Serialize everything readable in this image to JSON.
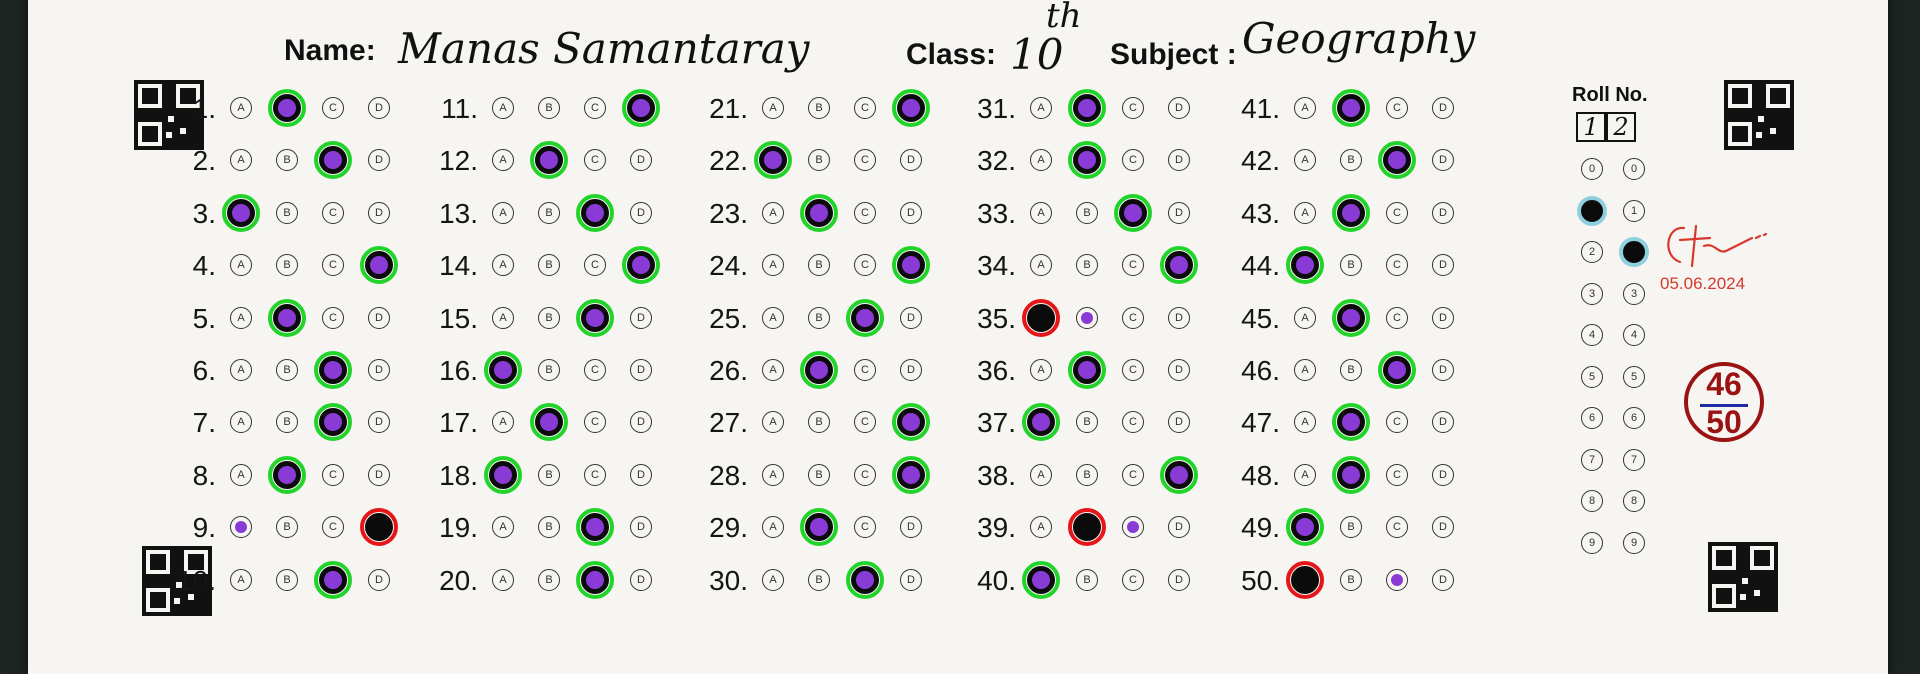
{
  "header": {
    "name_label": "Name:",
    "name_value": "Manas Samantaray",
    "class_label": "Class:",
    "class_value": "10",
    "class_sup": "th",
    "subject_label": "Subject :",
    "subject_value": "Geography"
  },
  "roll": {
    "label": "Roll No.",
    "digits": [
      "1",
      "2"
    ],
    "column_values": [
      "0",
      "1",
      "2",
      "3",
      "4",
      "5",
      "6",
      "7",
      "8",
      "9"
    ],
    "filled": [
      1,
      2
    ]
  },
  "signature": {
    "date": "05.06.2024"
  },
  "score": {
    "obtained": "46",
    "total": "50"
  },
  "colors": {
    "correct_ring": "#22d42a",
    "wrong_ring": "#e5161a",
    "answer_key_dot": "#8a3bd6",
    "score_ink": "#9b1212"
  },
  "option_labels": [
    "A",
    "B",
    "C",
    "D"
  ],
  "questions": [
    {
      "n": "1.",
      "marked": "B",
      "key": "B",
      "result": "correct"
    },
    {
      "n": "2.",
      "marked": "C",
      "key": "C",
      "result": "correct"
    },
    {
      "n": "3.",
      "marked": "A",
      "key": "A",
      "result": "correct"
    },
    {
      "n": "4.",
      "marked": "D",
      "key": "D",
      "result": "correct"
    },
    {
      "n": "5.",
      "marked": "B",
      "key": "B",
      "result": "correct"
    },
    {
      "n": "6.",
      "marked": "C",
      "key": "C",
      "result": "correct"
    },
    {
      "n": "7.",
      "marked": "C",
      "key": "C",
      "result": "correct"
    },
    {
      "n": "8.",
      "marked": "B",
      "key": "B",
      "result": "correct"
    },
    {
      "n": "9.",
      "marked": "D",
      "key": "A",
      "result": "wrong"
    },
    {
      "n": "10.",
      "marked": "C",
      "key": "C",
      "result": "correct"
    },
    {
      "n": "11.",
      "marked": "D",
      "key": "D",
      "result": "correct"
    },
    {
      "n": "12.",
      "marked": "B",
      "key": "B",
      "result": "correct"
    },
    {
      "n": "13.",
      "marked": "C",
      "key": "C",
      "result": "correct"
    },
    {
      "n": "14.",
      "marked": "D",
      "key": "D",
      "result": "correct"
    },
    {
      "n": "15.",
      "marked": "C",
      "key": "C",
      "result": "correct"
    },
    {
      "n": "16.",
      "marked": "A",
      "key": "A",
      "result": "correct"
    },
    {
      "n": "17.",
      "marked": "B",
      "key": "B",
      "result": "correct"
    },
    {
      "n": "18.",
      "marked": "A",
      "key": "A",
      "result": "correct"
    },
    {
      "n": "19.",
      "marked": "C",
      "key": "C",
      "result": "correct"
    },
    {
      "n": "20.",
      "marked": "C",
      "key": "C",
      "result": "correct"
    },
    {
      "n": "21.",
      "marked": "D",
      "key": "D",
      "result": "correct"
    },
    {
      "n": "22.",
      "marked": "A",
      "key": "A",
      "result": "correct"
    },
    {
      "n": "23.",
      "marked": "B",
      "key": "B",
      "result": "correct"
    },
    {
      "n": "24.",
      "marked": "D",
      "key": "D",
      "result": "correct"
    },
    {
      "n": "25.",
      "marked": "C",
      "key": "C",
      "result": "correct"
    },
    {
      "n": "26.",
      "marked": "B",
      "key": "B",
      "result": "correct"
    },
    {
      "n": "27.",
      "marked": "D",
      "key": "D",
      "result": "correct"
    },
    {
      "n": "28.",
      "marked": "D",
      "key": "D",
      "result": "correct"
    },
    {
      "n": "29.",
      "marked": "B",
      "key": "B",
      "result": "correct"
    },
    {
      "n": "30.",
      "marked": "C",
      "key": "C",
      "result": "correct"
    },
    {
      "n": "31.",
      "marked": "B",
      "key": "B",
      "result": "correct"
    },
    {
      "n": "32.",
      "marked": "B",
      "key": "B",
      "result": "correct"
    },
    {
      "n": "33.",
      "marked": "C",
      "key": "C",
      "result": "correct"
    },
    {
      "n": "34.",
      "marked": "D",
      "key": "D",
      "result": "correct"
    },
    {
      "n": "35.",
      "marked": "A",
      "key": "B",
      "result": "wrong"
    },
    {
      "n": "36.",
      "marked": "B",
      "key": "B",
      "result": "correct"
    },
    {
      "n": "37.",
      "marked": "A",
      "key": "A",
      "result": "correct"
    },
    {
      "n": "38.",
      "marked": "D",
      "key": "D",
      "result": "correct"
    },
    {
      "n": "39.",
      "marked": "B",
      "key": "C",
      "result": "wrong"
    },
    {
      "n": "40.",
      "marked": "A",
      "key": "A",
      "result": "correct"
    },
    {
      "n": "41.",
      "marked": "B",
      "key": "B",
      "result": "correct"
    },
    {
      "n": "42.",
      "marked": "C",
      "key": "C",
      "result": "correct"
    },
    {
      "n": "43.",
      "marked": "B",
      "key": "B",
      "result": "correct"
    },
    {
      "n": "44.",
      "marked": "A",
      "key": "A",
      "result": "correct"
    },
    {
      "n": "45.",
      "marked": "B",
      "key": "B",
      "result": "correct"
    },
    {
      "n": "46.",
      "marked": "C",
      "key": "C",
      "result": "correct"
    },
    {
      "n": "47.",
      "marked": "B",
      "key": "B",
      "result": "correct"
    },
    {
      "n": "48.",
      "marked": "B",
      "key": "B",
      "result": "correct"
    },
    {
      "n": "49.",
      "marked": "A",
      "key": "A",
      "result": "correct"
    },
    {
      "n": "50.",
      "marked": "A",
      "key": "C",
      "result": "wrong"
    }
  ]
}
